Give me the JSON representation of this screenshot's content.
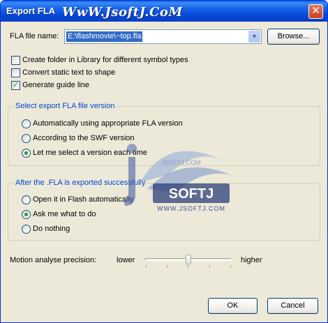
{
  "window": {
    "title": "Export FLA",
    "watermark": "WwW.JsoftJ.CoM",
    "close_glyph": "✕"
  },
  "file": {
    "label": "FLA file name:",
    "value": "E:\\flashmovie\\~top.fla",
    "dropdown_glyph": "▼",
    "browse_label": "Browse..."
  },
  "options": [
    {
      "label": "Create folder in Library for different symbol types",
      "checked": false
    },
    {
      "label": "Convert static text to shape",
      "checked": false
    },
    {
      "label": "Generate guide line",
      "checked": true
    }
  ],
  "checkmark": "✓",
  "version_group": {
    "title": "Select export FLA file version",
    "items": [
      {
        "label": "Automatically using appropriate FLA version",
        "selected": false
      },
      {
        "label": "According to the SWF version",
        "selected": false
      },
      {
        "label": "Let me select a version each time",
        "selected": true
      }
    ]
  },
  "after_group": {
    "title": "After the .FLA is exported successfully",
    "items": [
      {
        "label": "Open it in Flash automatically",
        "selected": false
      },
      {
        "label": "Ask me what to do",
        "selected": true
      },
      {
        "label": "Do nothing",
        "selected": false
      }
    ]
  },
  "motion": {
    "label": "Motion analyse precision:",
    "lower": "lower",
    "higher": "higher",
    "level": 0.5
  },
  "buttons": {
    "ok": "OK",
    "cancel": "Cancel"
  },
  "watermark_logo": {
    "brand": "SOFTJ",
    "url": "WWW.JSOFTJ.COM",
    "small_url": "JSOFTJ.COM"
  },
  "colors": {
    "titlebar": "#0a48d8",
    "dialog_bg": "#ece9d8",
    "group_title": "#0046d5",
    "selection": "#316ac5",
    "radio_dot": "#21a121"
  }
}
